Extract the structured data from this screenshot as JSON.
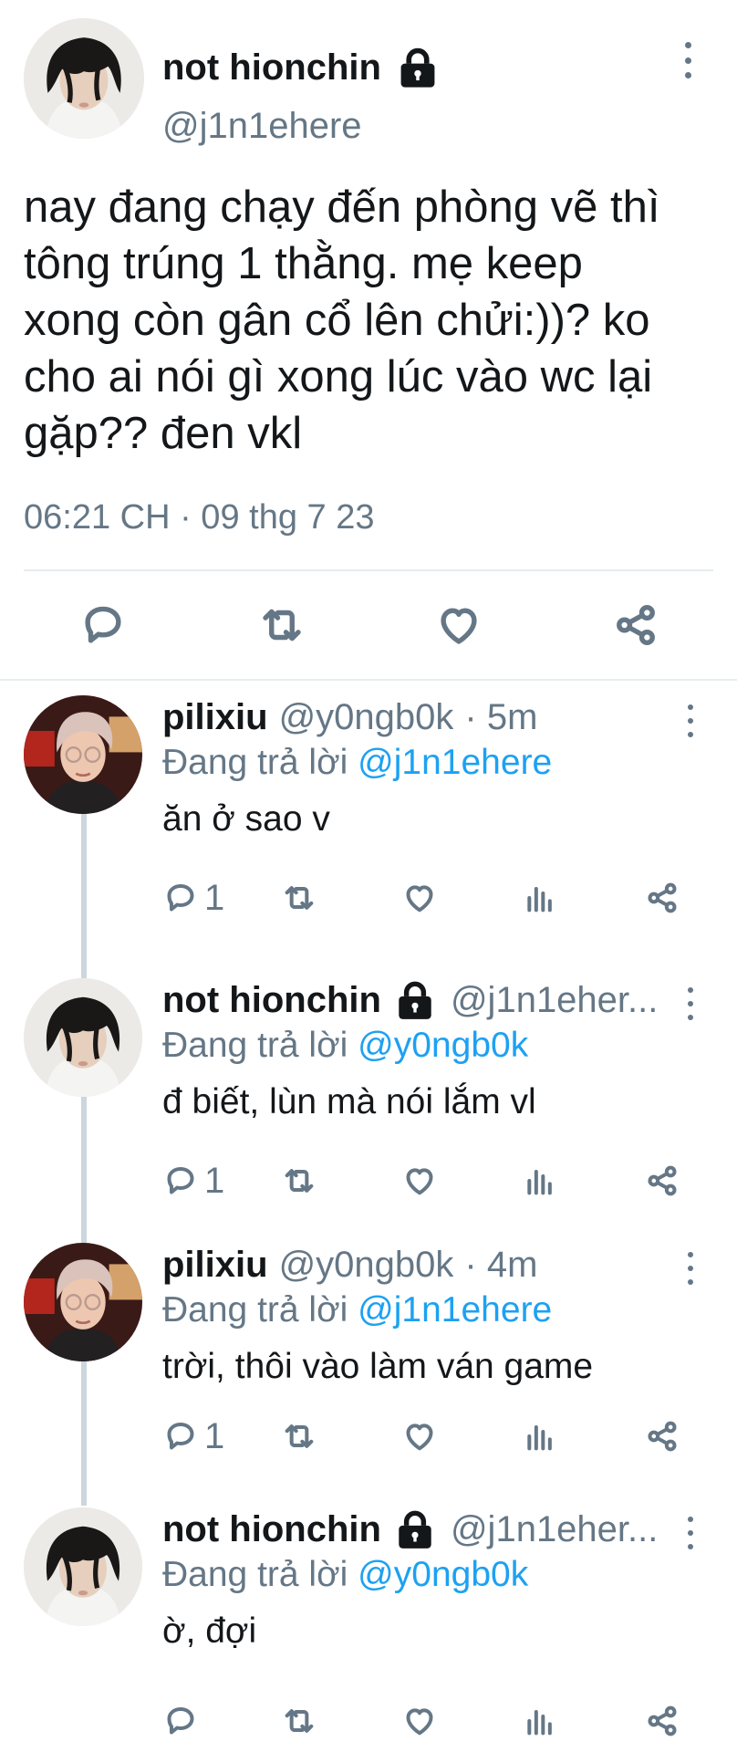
{
  "main_tweet": {
    "display_name": "not hionchin",
    "handle": "@j1n1ehere",
    "text": "nay đang chạy đến phòng vẽ thì\ntông trúng 1 thằng. mẹ keep\nxong còn gân cổ lên chửi:))? ko\ncho ai nói gì xong lúc vào wc lại\ngặp?? đen vkl",
    "timestamp": "06:21 CH · 09 thg 7 23",
    "actions": [
      "reply-icon",
      "retweet-icon",
      "like-icon",
      "share-icon"
    ]
  },
  "replies": [
    {
      "display_name": "pilixiu",
      "handle": "@y0ngb0k",
      "time": "· 5m",
      "protected": false,
      "replying_prefix": "Đang trả lời",
      "replying_to": "@j1n1ehere",
      "text": "ăn ở sao v",
      "reply_count": "1"
    },
    {
      "display_name": "not hionchin",
      "handle": "@j1n1eher...",
      "time": "",
      "protected": true,
      "replying_prefix": "Đang trả lời",
      "replying_to": "@y0ngb0k",
      "text": "đ biết, lùn mà nói lắm vl",
      "reply_count": "1"
    },
    {
      "display_name": "pilixiu",
      "handle": "@y0ngb0k",
      "time": "· 4m",
      "protected": false,
      "replying_prefix": "Đang trả lời",
      "replying_to": "@j1n1ehere",
      "text": "trời, thôi vào làm ván game",
      "reply_count": "1"
    },
    {
      "display_name": "not hionchin",
      "handle": "@j1n1eher...",
      "time": "",
      "protected": true,
      "replying_prefix": "Đang trả lời",
      "replying_to": "@y0ngb0k",
      "text": "ờ, đợi",
      "reply_count": ""
    }
  ],
  "colors": {
    "text": "#14171a",
    "secondary": "#657786",
    "mention": "#1da1f2",
    "divider": "#e6ecf0",
    "thread_line": "#ccd6dd"
  }
}
